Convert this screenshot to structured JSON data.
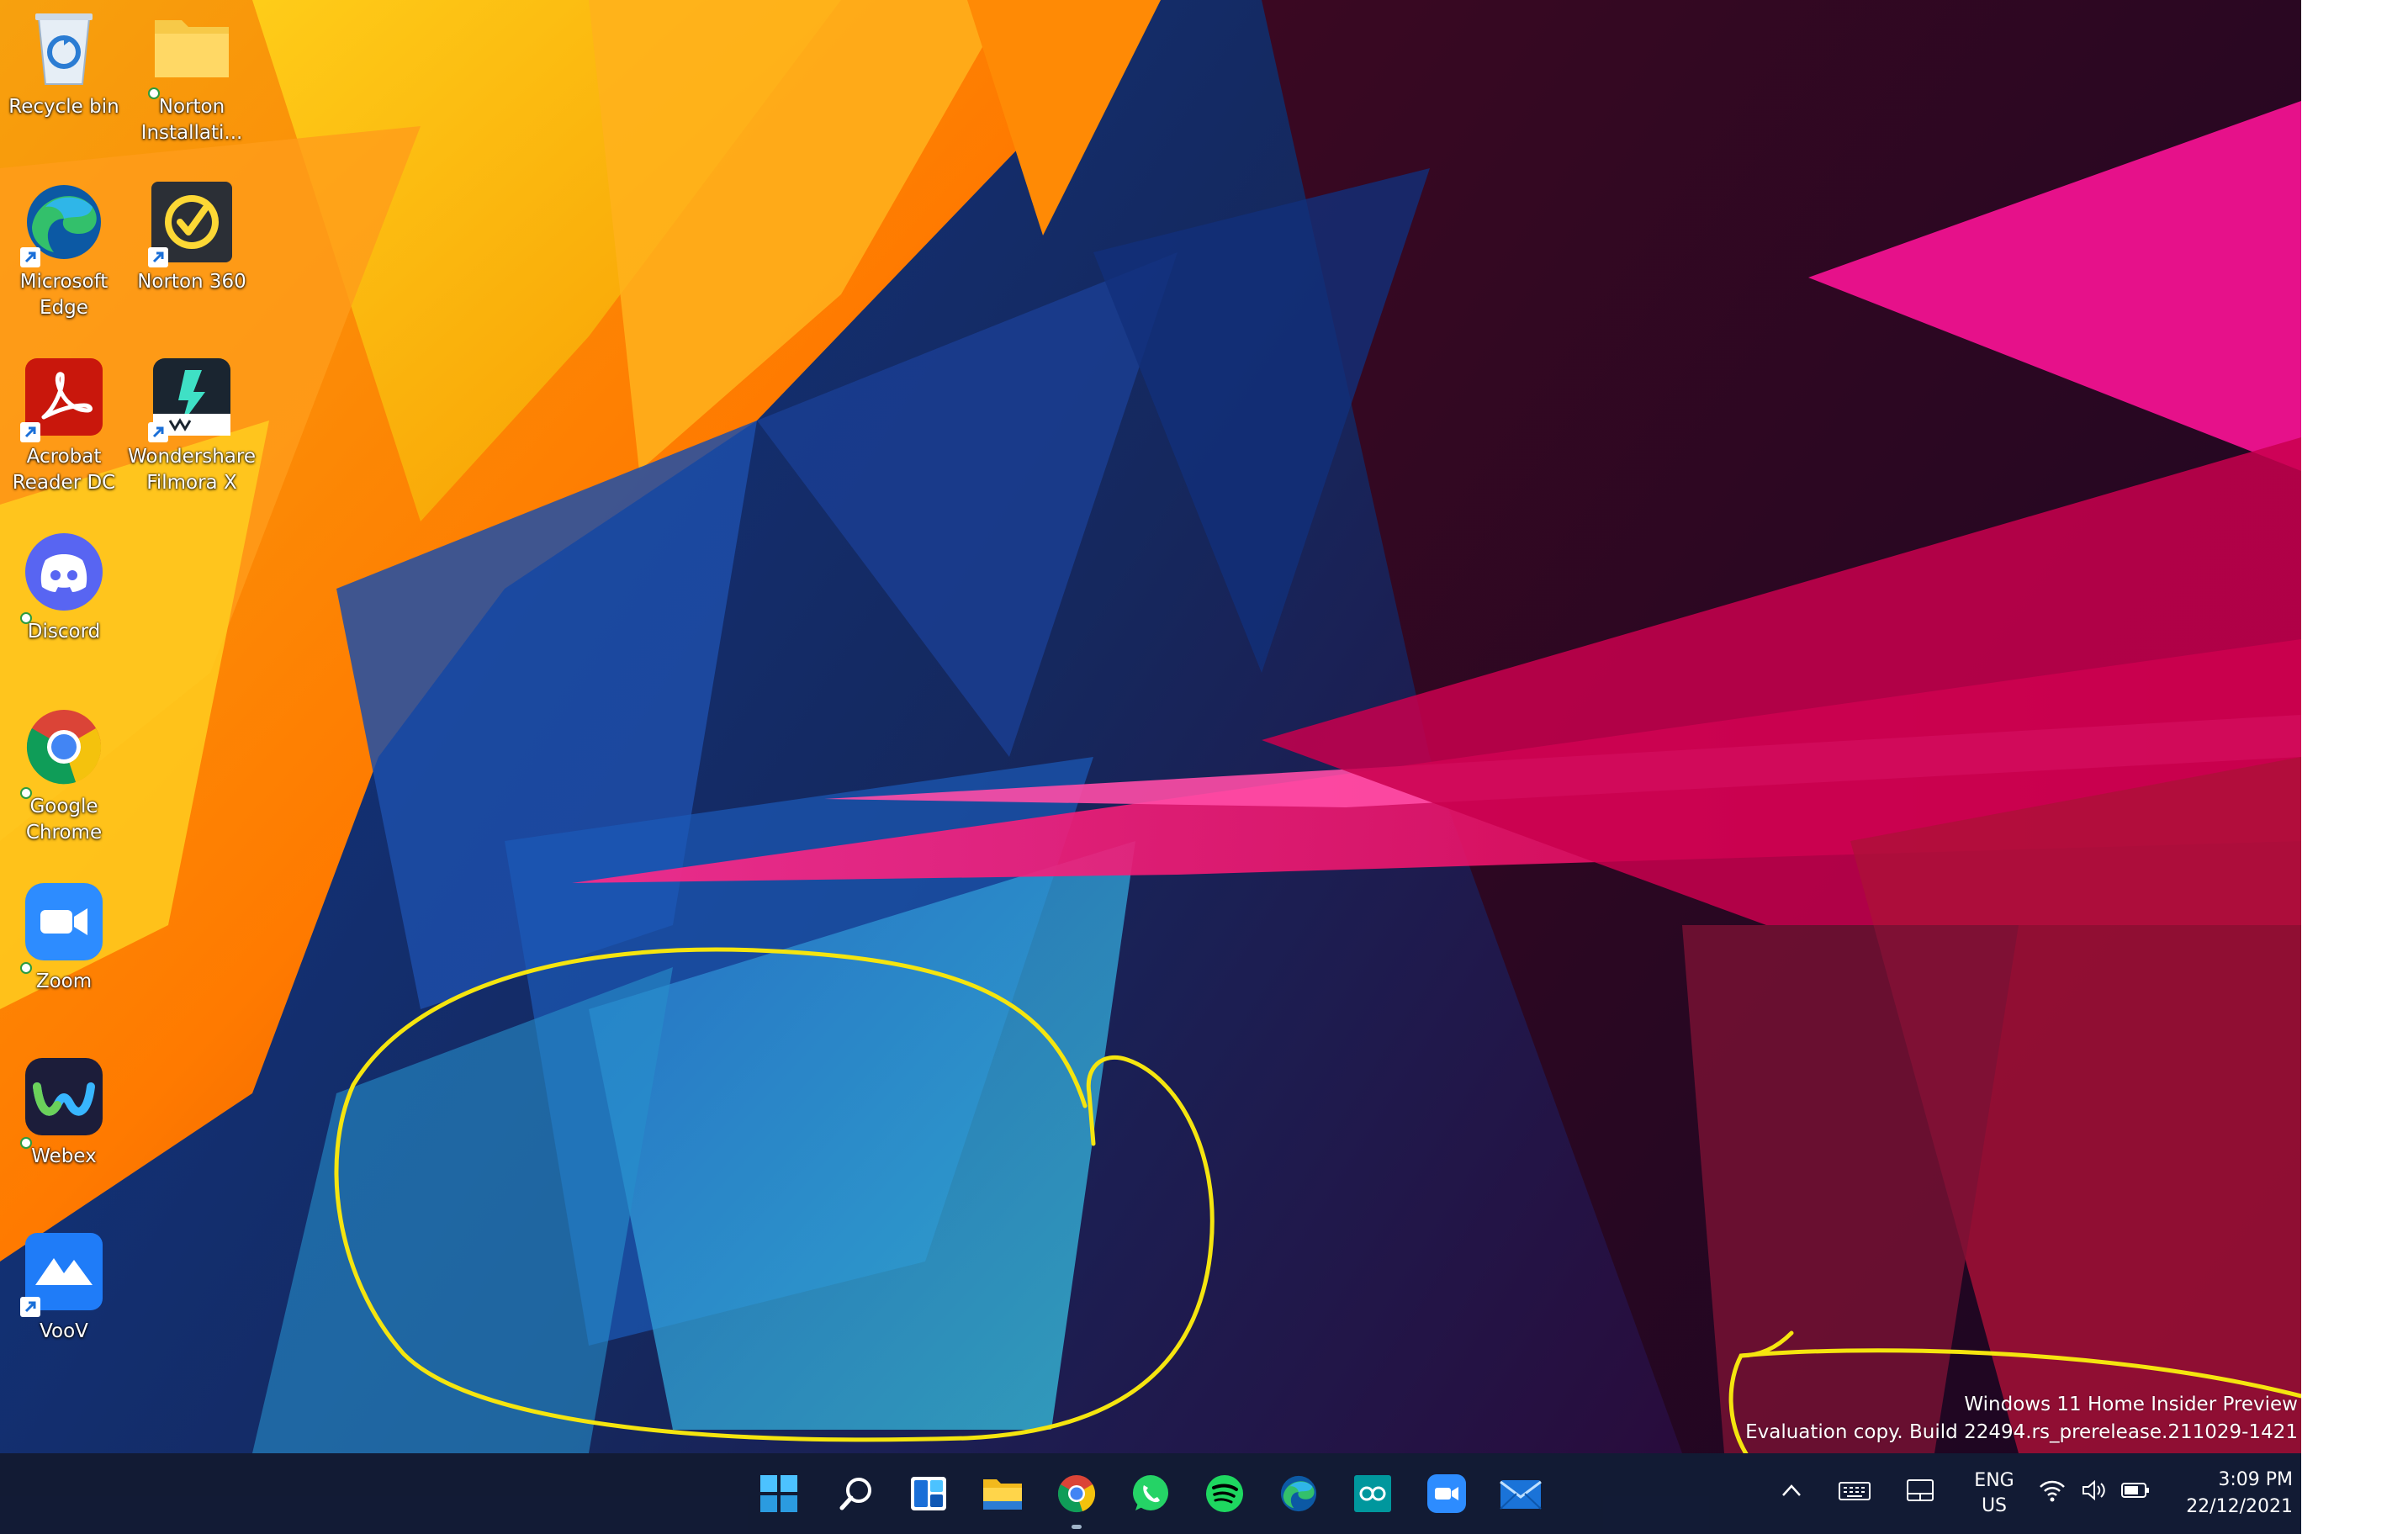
{
  "desktop": {
    "icons": [
      {
        "label": "Recycle bin",
        "icon": "recycle-bin-icon"
      },
      {
        "label": "Norton Installati...",
        "icon": "folder-icon"
      },
      {
        "label": "Microsoft Edge",
        "icon": "edge-icon"
      },
      {
        "label": "Norton 360",
        "icon": "norton-icon"
      },
      {
        "label": "Acrobat Reader DC",
        "icon": "acrobat-icon"
      },
      {
        "label": "Wondershare Filmora X",
        "icon": "filmora-icon"
      },
      {
        "label": "Discord",
        "icon": "discord-icon"
      },
      {
        "label": "Google Chrome",
        "icon": "chrome-icon"
      },
      {
        "label": "Zoom",
        "icon": "zoom-icon"
      },
      {
        "label": "Webex",
        "icon": "webex-icon"
      },
      {
        "label": "VooV",
        "icon": "voov-icon"
      }
    ]
  },
  "watermark": {
    "line1": "Windows 11 Home Insider Preview",
    "line2": "Evaluation copy. Build 22494.rs_prerelease.211029-1421"
  },
  "taskbar": {
    "apps": [
      "start-icon",
      "search-icon",
      "widgets-icon",
      "file-explorer-icon",
      "chrome-icon",
      "whatsapp-icon",
      "spotify-icon",
      "edge-icon",
      "arduino-icon",
      "zoom-icon",
      "mail-icon"
    ]
  },
  "tray": {
    "lang_top": "ENG",
    "lang_bottom": "US",
    "time": "3:09 PM",
    "date": "22/12/2021"
  },
  "colors": {
    "annotation": "#f5e50f",
    "taskbar": "#121a30"
  }
}
